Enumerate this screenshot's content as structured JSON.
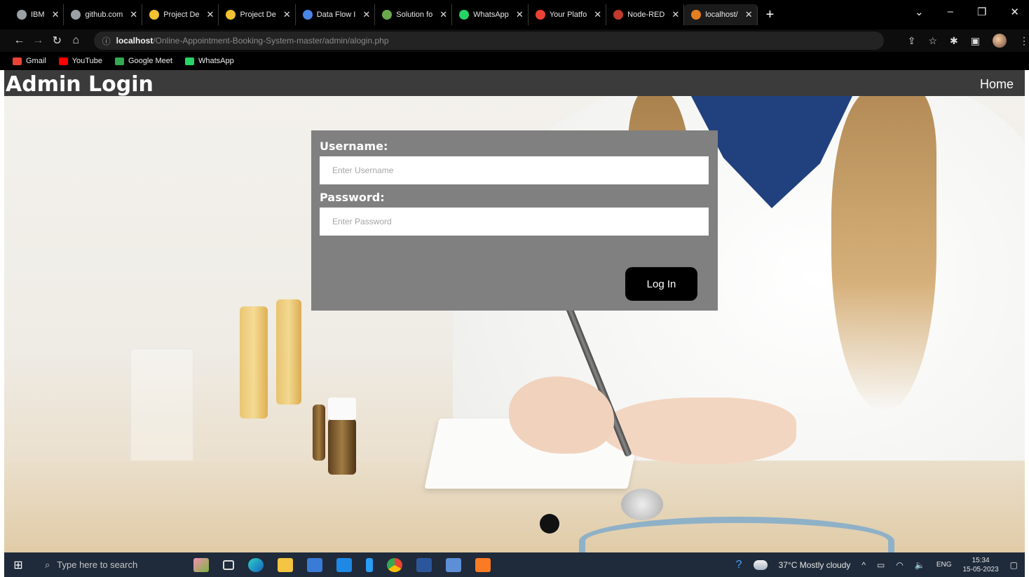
{
  "browser": {
    "tabs": [
      {
        "label": "IBM",
        "color": "#9aa0a6",
        "active": false
      },
      {
        "label": "github.com",
        "color": "#9aa0a6",
        "active": false
      },
      {
        "label": "Project De",
        "color": "#f1c232",
        "active": false
      },
      {
        "label": "Project De",
        "color": "#f1c232",
        "active": false
      },
      {
        "label": "Data Flow I",
        "color": "#4a86e8",
        "active": false
      },
      {
        "label": "Solution fo",
        "color": "#6aa84f",
        "active": false
      },
      {
        "label": "WhatsApp",
        "color": "#25d366",
        "active": false
      },
      {
        "label": "Your Platfo",
        "color": "#ea4335",
        "active": false
      },
      {
        "label": "Node-RED",
        "color": "#c0392b",
        "active": false
      },
      {
        "label": "localhost/",
        "color": "#e67e22",
        "active": true
      }
    ],
    "url_host": "localhost",
    "url_path": "/Online-Appointment-Booking-System-master/admin/alogin.php",
    "bookmarks": [
      {
        "label": "Gmail",
        "color": "#ea4335"
      },
      {
        "label": "YouTube",
        "color": "#ff0000"
      },
      {
        "label": "Google Meet",
        "color": "#34a853"
      },
      {
        "label": "WhatsApp",
        "color": "#25d366"
      }
    ]
  },
  "page": {
    "title": "Admin Login",
    "nav_home": "Home"
  },
  "login": {
    "username_label": "Username:",
    "username_placeholder": "Enter Username",
    "password_label": "Password:",
    "password_placeholder": "Enter Password",
    "submit_label": "Log In"
  },
  "taskbar": {
    "search_placeholder": "Type here to search",
    "weather": "37°C  Mostly cloudy",
    "language": "ENG",
    "time": "15:34",
    "date": "15-05-2023"
  },
  "colors": {
    "topbar": "#3b3b3b",
    "login_panel": "#808080",
    "button": "#000000"
  }
}
